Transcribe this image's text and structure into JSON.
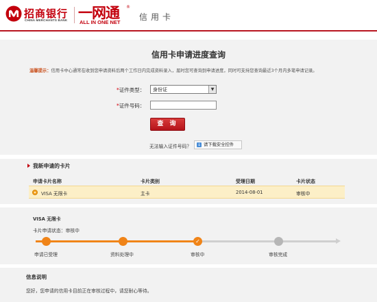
{
  "header": {
    "bank_name": "招商银行",
    "bank_name_en": "CHINA MERCHANTS BANK",
    "product_cn": "一网通",
    "product_reg": "®",
    "product_en": "ALL IN ONE NET",
    "section": "信用卡",
    "brand_color": "#c3000d"
  },
  "query": {
    "title": "信用卡申请进度查询",
    "tip_label": "温馨提示：",
    "tip_text": "信用卡中心通常在收到您申请资料后两个工作日内完成资料录入，届时您可查询到申请进度，同时可支持您查询最近3个月内多笔申请记录。",
    "star": "*",
    "id_type_label": "证件类型：",
    "id_type_value": "身份证",
    "id_no_label": "证件号码：",
    "id_no_value": "",
    "query_button": "查 询",
    "cant_input_text": "无法输入证件号码？",
    "download_button": "请下载安全控件"
  },
  "applications": {
    "title": "我新申请的卡片",
    "columns": [
      "申请卡片名称",
      "卡片类别",
      "受理日期",
      "卡片状态"
    ],
    "rows": [
      {
        "name": "VISA 无限卡",
        "type": "主卡",
        "date": "2014-08-01",
        "status": "审核中",
        "selected": true
      }
    ]
  },
  "progress": {
    "card_name": "VISA 无限卡",
    "status_text": "卡片申请状态：审核中",
    "steps": [
      {
        "label": "申请已受理",
        "state": "done"
      },
      {
        "label": "资料处理中",
        "state": "done"
      },
      {
        "label": "审核中",
        "state": "current"
      },
      {
        "label": "审核完成",
        "state": "pending"
      }
    ],
    "active_color": "#f08418",
    "inactive_color": "#b6b6b6"
  },
  "info": {
    "title": "信息说明",
    "text": "您好，您申请的信用卡目前正在审核过程中，请您耐心等待。"
  }
}
